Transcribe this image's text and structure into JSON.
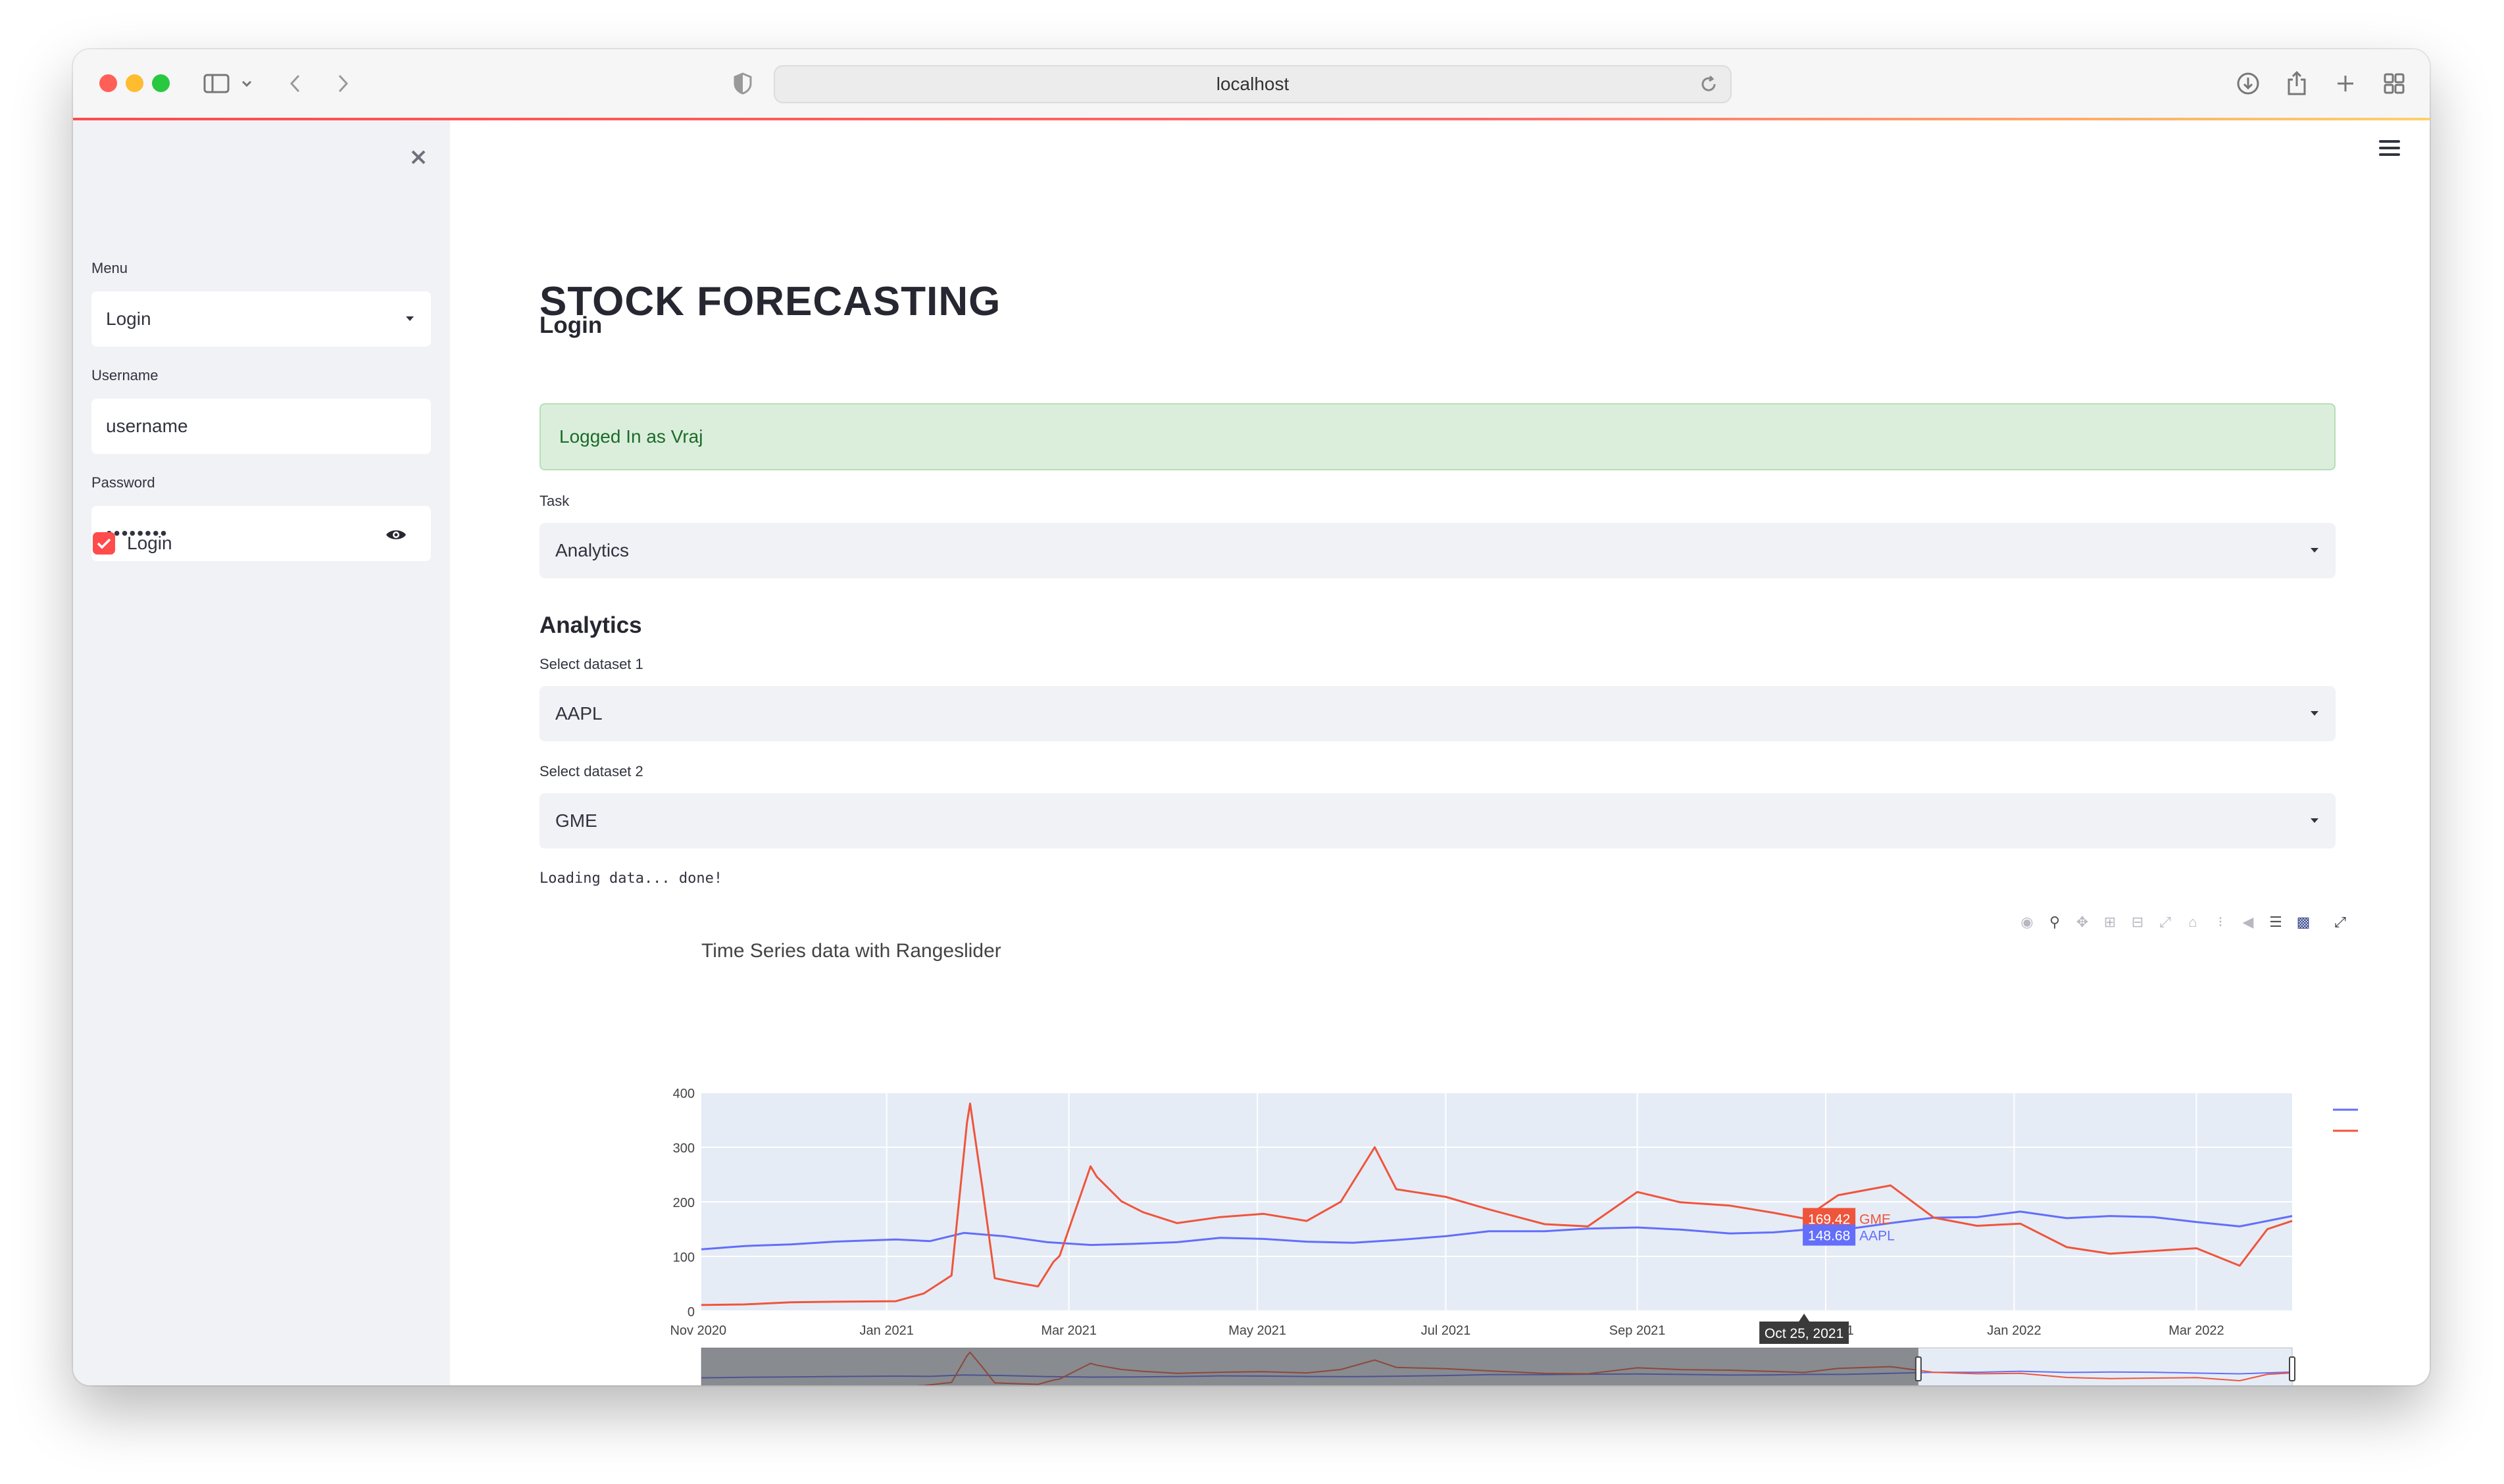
{
  "browser": {
    "url": "localhost"
  },
  "sidebar": {
    "menu_label": "Menu",
    "menu_value": "Login",
    "username_label": "Username",
    "username_value": "username",
    "password_label": "Password",
    "password_value": "••••••••",
    "login_checkbox_label": "Login",
    "login_checked": true
  },
  "main": {
    "title": "STOCK FORECASTING",
    "login_header": "Login",
    "success_message": "Logged In as Vraj",
    "task_label": "Task",
    "task_value": "Analytics",
    "analytics_header": "Analytics",
    "dataset1_label": "Select dataset 1",
    "dataset1_value": "AAPL",
    "dataset2_label": "Select dataset 2",
    "dataset2_value": "GME",
    "loading_text": "Loading data... done!"
  },
  "colors": {
    "aapl": "#636efa",
    "gme": "#ef553b",
    "accent": "#ff4b4b",
    "success_bg": "#dbeedb"
  },
  "chart_data": {
    "type": "line",
    "title": "Time Series data with Rangeslider",
    "xlabel": "",
    "ylabel": "",
    "ylim": [
      0,
      400
    ],
    "y_ticks": [
      "0",
      "100",
      "200",
      "300",
      "400"
    ],
    "x_ticks": [
      "Nov 2020",
      "Jan 2021",
      "Mar 2021",
      "May 2021",
      "Jul 2021",
      "Sep 2021",
      "Nov 2021",
      "Jan 2022",
      "Mar 2022"
    ],
    "x_range": [
      "2020-11-02",
      "2022-04-01"
    ],
    "grid": true,
    "legend_position": "top-right",
    "has_rangeslider": true,
    "hover": {
      "date_label": "Oct 25, 2021",
      "gme_value": "169.42",
      "gme_name": "GME",
      "aapl_value": "148.68",
      "aapl_name": "AAPL"
    },
    "series": [
      {
        "name": "AAPL",
        "x": [
          "2020-11-02",
          "2020-11-16",
          "2020-12-01",
          "2020-12-15",
          "2021-01-04",
          "2021-01-15",
          "2021-01-26",
          "2021-02-08",
          "2021-02-22",
          "2021-03-08",
          "2021-03-22",
          "2021-04-05",
          "2021-04-19",
          "2021-05-03",
          "2021-05-17",
          "2021-06-01",
          "2021-06-15",
          "2021-07-01",
          "2021-07-15",
          "2021-08-02",
          "2021-08-16",
          "2021-09-01",
          "2021-09-15",
          "2021-10-01",
          "2021-10-15",
          "2021-10-25",
          "2021-11-08",
          "2021-11-22",
          "2021-12-06",
          "2021-12-20",
          "2022-01-03",
          "2022-01-18",
          "2022-02-01",
          "2022-02-15",
          "2022-03-01",
          "2022-03-15",
          "2022-04-01"
        ],
        "values": [
          113,
          119,
          122,
          127,
          131,
          128,
          143,
          137,
          126,
          121,
          123,
          126,
          134,
          132,
          127,
          125,
          130,
          137,
          146,
          146,
          151,
          153,
          149,
          142,
          144,
          148.7,
          150,
          161,
          171,
          172,
          182,
          170,
          174,
          172,
          163,
          155,
          174
        ]
      },
      {
        "name": "GME",
        "x": [
          "2020-11-02",
          "2020-11-16",
          "2020-12-01",
          "2020-12-15",
          "2021-01-04",
          "2021-01-13",
          "2021-01-22",
          "2021-01-27",
          "2021-01-28",
          "2021-02-01",
          "2021-02-05",
          "2021-02-12",
          "2021-02-19",
          "2021-02-24",
          "2021-02-26",
          "2021-03-08",
          "2021-03-10",
          "2021-03-18",
          "2021-03-25",
          "2021-04-05",
          "2021-04-19",
          "2021-05-03",
          "2021-05-17",
          "2021-05-28",
          "2021-06-08",
          "2021-06-15",
          "2021-07-01",
          "2021-07-15",
          "2021-08-02",
          "2021-08-16",
          "2021-09-01",
          "2021-09-15",
          "2021-10-01",
          "2021-10-15",
          "2021-10-25",
          "2021-11-05",
          "2021-11-22",
          "2021-12-06",
          "2021-12-20",
          "2022-01-03",
          "2022-01-18",
          "2022-02-01",
          "2022-02-15",
          "2022-03-01",
          "2022-03-15",
          "2022-03-24",
          "2022-04-01"
        ],
        "values": [
          11,
          12,
          16,
          17,
          18,
          32,
          65,
          345,
          380,
          225,
          60,
          52,
          45,
          90,
          101,
          265,
          246,
          201,
          181,
          161,
          172,
          178,
          165,
          200,
          300,
          223,
          209,
          186,
          159,
          155,
          218,
          199,
          193,
          180,
          169.4,
          212,
          230,
          171,
          156,
          160,
          117,
          105,
          110,
          115,
          83,
          150,
          165
        ]
      }
    ]
  }
}
